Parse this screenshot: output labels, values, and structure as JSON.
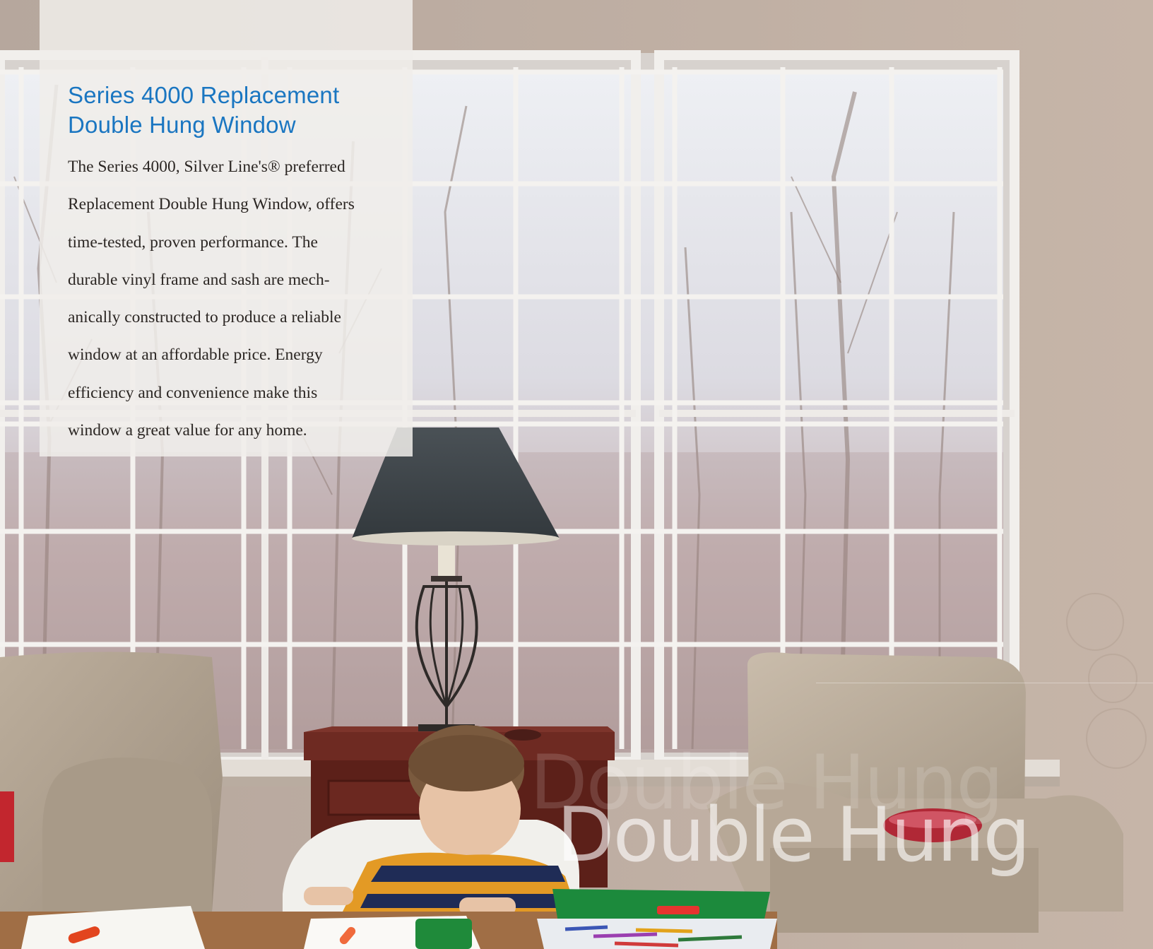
{
  "headline": {
    "lines": [
      "Series 4000 Replacement",
      "Double Hung Window"
    ]
  },
  "body": {
    "lines": [
      "The Series 4000, Silver Line's® preferred",
      "Replacement Double Hung Window, offers",
      "time-tested, proven performance.  The",
      "durable vinyl frame and sash are mech-",
      "anically constructed to produce a reliable",
      "window at an affordable price.  Energy",
      "efficiency and convenience make this",
      "window a great value for any home."
    ]
  },
  "watermark": "Double Hung",
  "colors": {
    "headline": "#1a76c1",
    "body_text": "#2b2623",
    "panel": "#f0edea"
  }
}
